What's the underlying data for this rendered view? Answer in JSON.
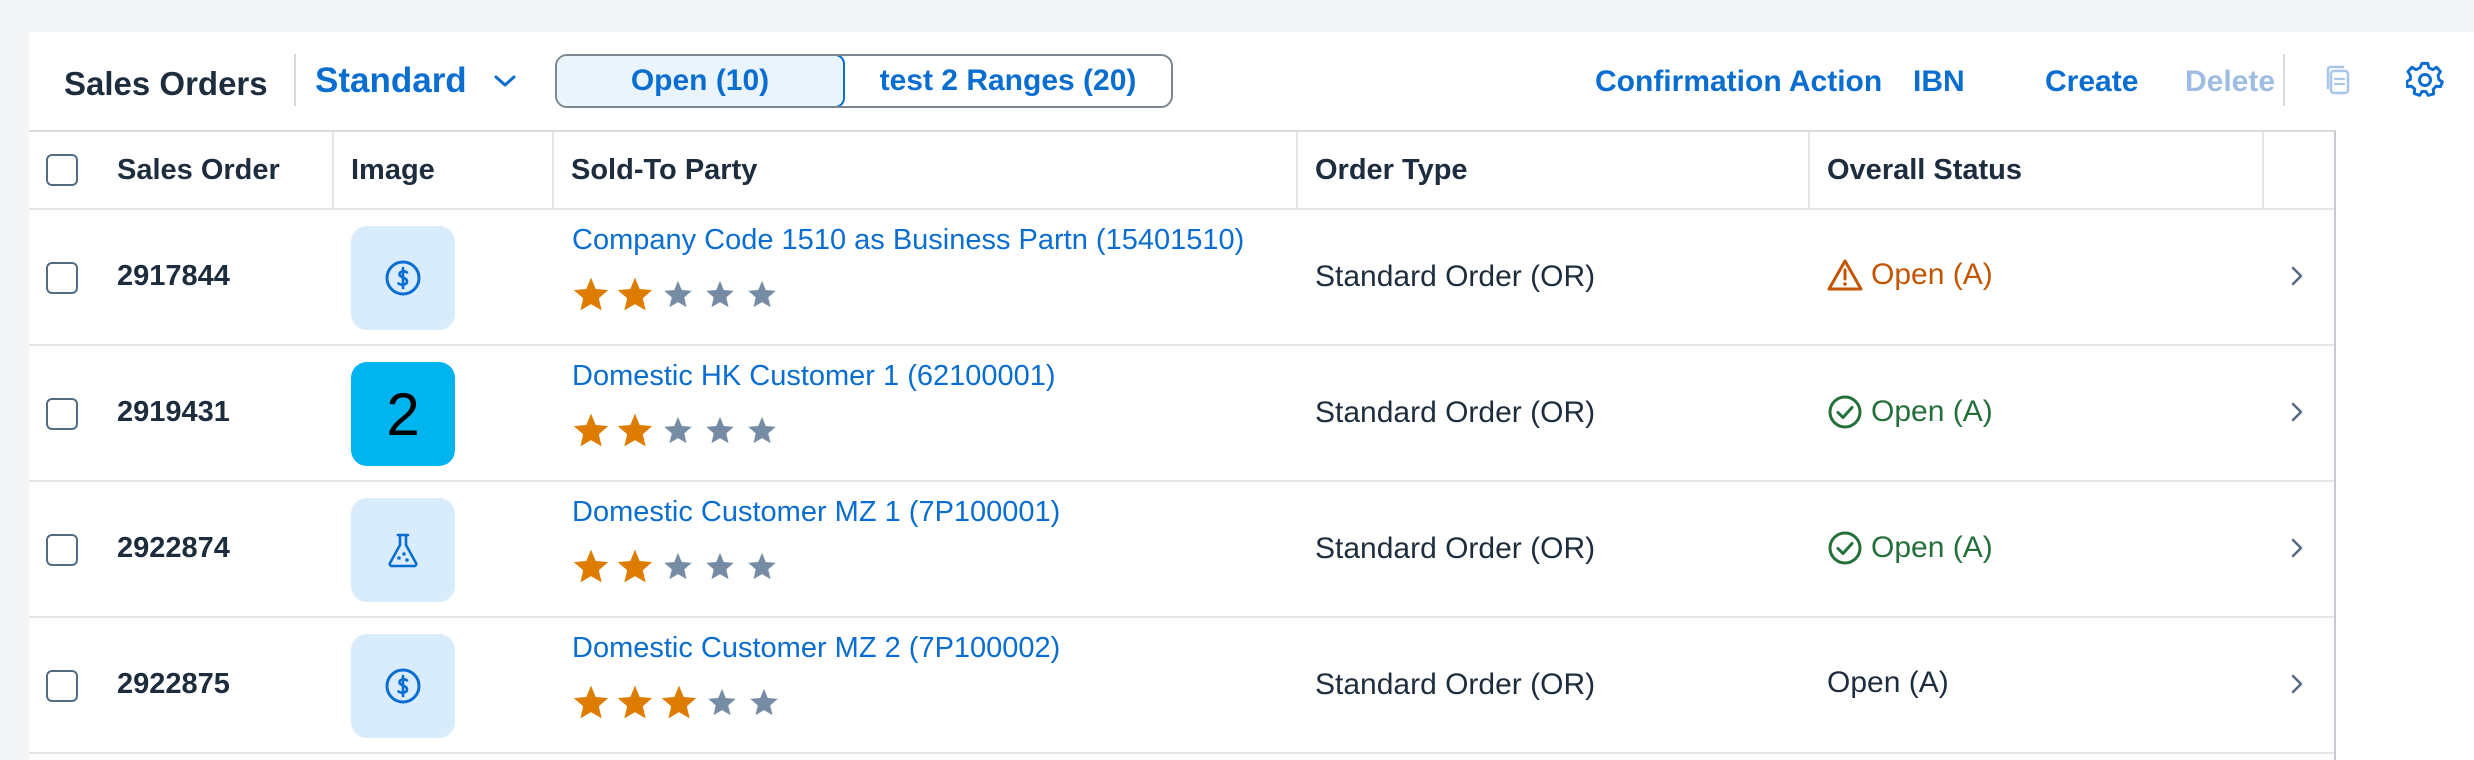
{
  "toolbar": {
    "title": "Sales Orders",
    "variant": "Standard",
    "segments": [
      "Open (10)",
      "test 2 Ranges (20)"
    ],
    "actions": {
      "confirmation": "Confirmation Action",
      "ibn": "IBN",
      "create": "Create",
      "delete": "Delete"
    }
  },
  "table": {
    "columns": {
      "sales_order": "Sales Order",
      "image": "Image",
      "sold_to": "Sold-To Party",
      "order_type": "Order Type",
      "overall_status": "Overall Status"
    },
    "rows": [
      {
        "sales_order": "2917844",
        "image": "dollar-icon",
        "sold_to": "Company Code 1510 as Business Partn (15401510)",
        "rating": 2,
        "order_type": "Standard Order (OR)",
        "status": "Open (A)",
        "status_state": "warning"
      },
      {
        "sales_order": "2919431",
        "image": "2",
        "sold_to": "Domestic HK Customer 1 (62100001)",
        "rating": 2,
        "order_type": "Standard Order (OR)",
        "status": "Open (A)",
        "status_state": "success"
      },
      {
        "sales_order": "2922874",
        "image": "flask-icon",
        "sold_to": "Domestic Customer MZ 1 (7P100001)",
        "rating": 2,
        "order_type": "Standard Order (OR)",
        "status": "Open (A)",
        "status_state": "success"
      },
      {
        "sales_order": "2922875",
        "image": "dollar-icon",
        "sold_to": "Domestic Customer MZ 2 (7P100002)",
        "rating": 3,
        "order_type": "Standard Order (OR)",
        "status": "Open (A)",
        "status_state": "none"
      }
    ]
  },
  "colors": {
    "link": "#0a6ed1",
    "warning": "#c35500",
    "success": "#256f3a",
    "star_filled": "#de7c00",
    "star_empty": "#758ca4"
  }
}
